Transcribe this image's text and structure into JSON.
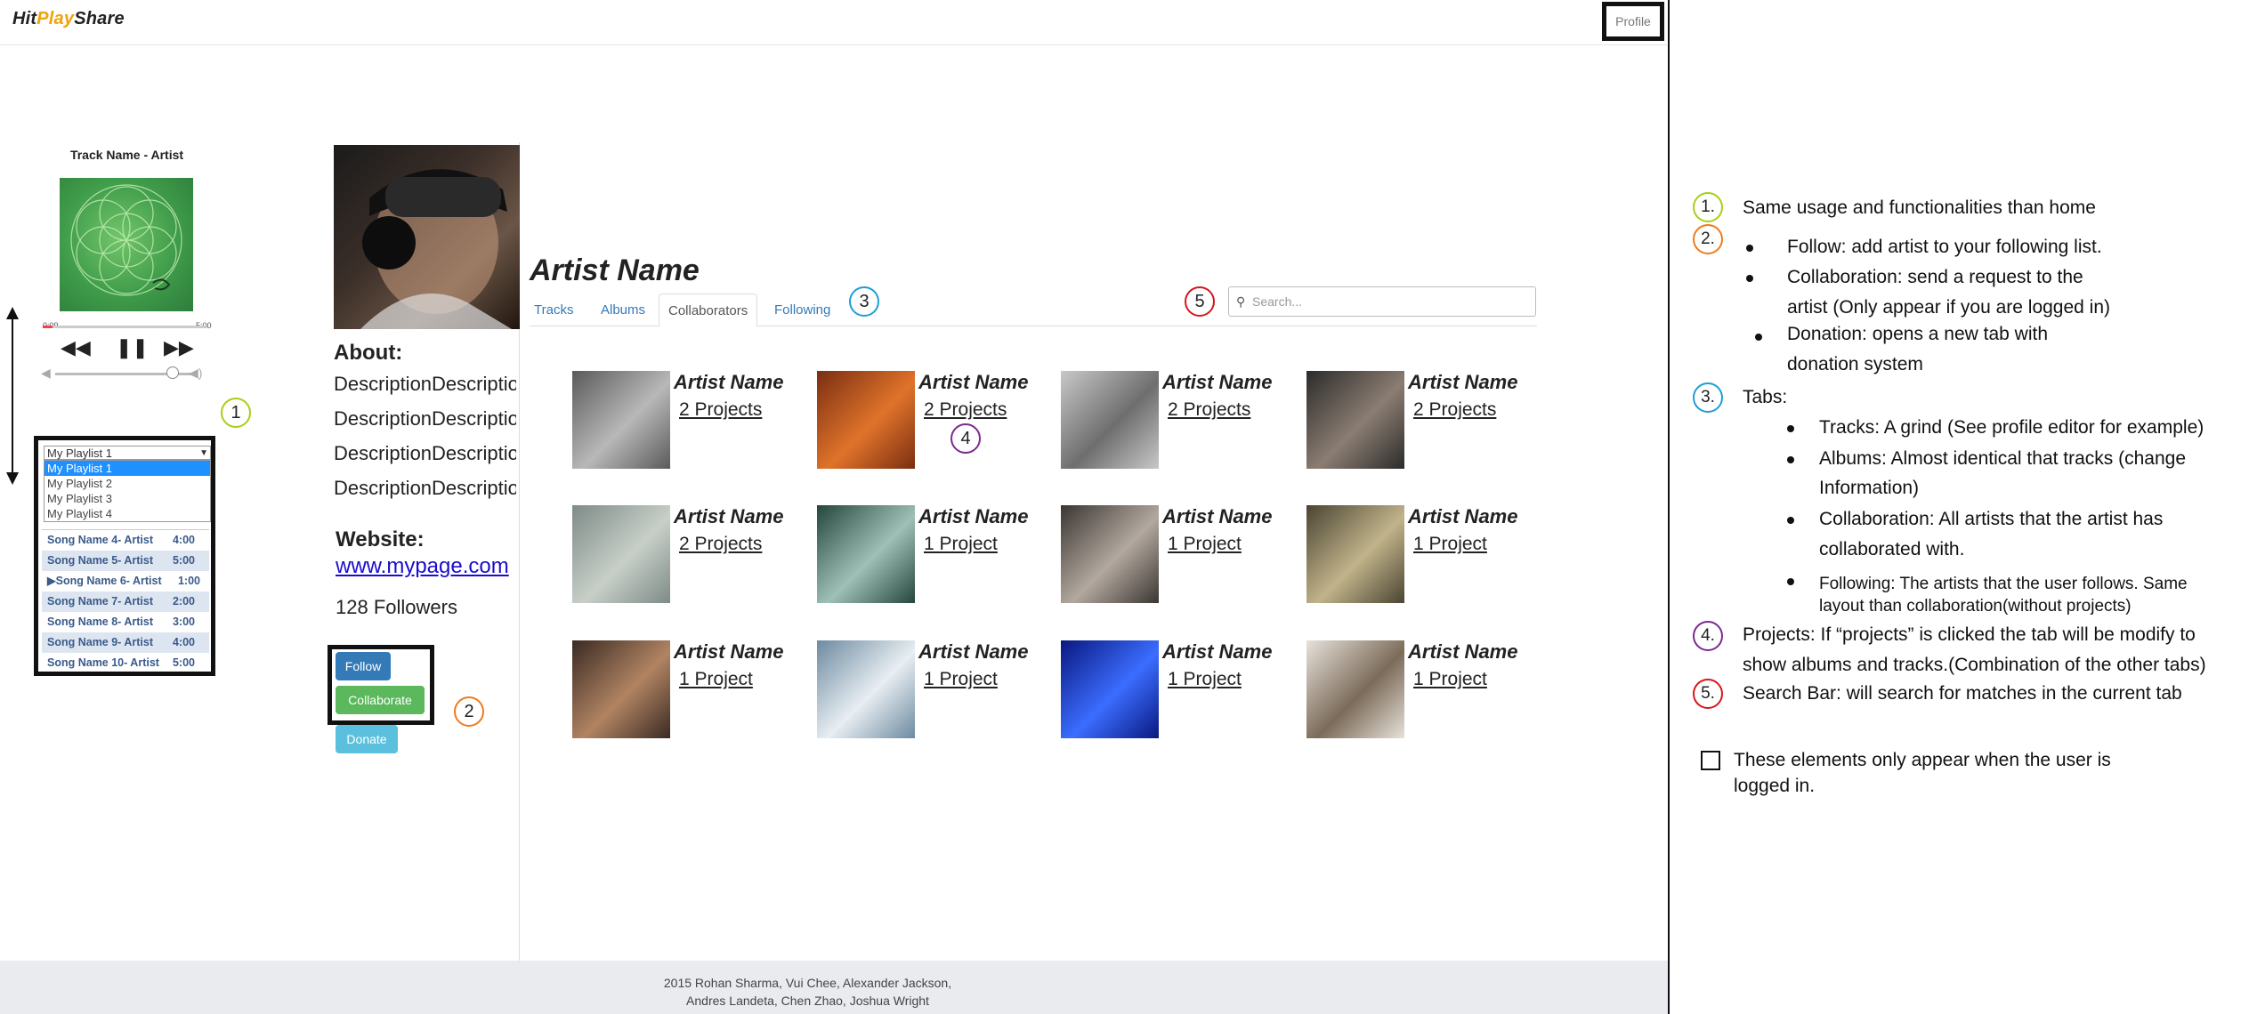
{
  "header": {
    "logo_hit": "Hit",
    "logo_play": "Play",
    "logo_share": "Share",
    "profile_label": "Profile"
  },
  "player": {
    "track_title": "Track Name - Artist",
    "time_start": "0:09",
    "time_end": "5:00",
    "progress": 0.06,
    "volume": 0.82,
    "prev_icon": "rewind-icon",
    "pause_icon": "pause-icon",
    "next_icon": "fast-forward-icon",
    "selected_playlist": "My Playlist 1",
    "playlist_options": [
      "My Playlist 1",
      "My Playlist 2",
      "My Playlist 3",
      "My Playlist 4"
    ],
    "songs": [
      {
        "title": "Song Name 4- Artist",
        "duration": "4:00"
      },
      {
        "title": "Song Name 5- Artist",
        "duration": "5:00"
      },
      {
        "title": "Song Name 6- Artist",
        "duration": "1:00",
        "playing": true
      },
      {
        "title": "Song Name 7- Artist",
        "duration": "2:00"
      },
      {
        "title": "Song Name 8- Artist",
        "duration": "3:00"
      },
      {
        "title": "Song Name 9- Artist",
        "duration": "4:00"
      },
      {
        "title": "Song Name 10- Artist",
        "duration": "5:00"
      }
    ],
    "playing_marker": "▶"
  },
  "profile": {
    "about_label": "About:",
    "description_lines": [
      "DescriptionDescription",
      "DescriptionDescription",
      "DescriptionDescription",
      "DescriptionDescription"
    ],
    "website_label": "Website:",
    "website_url": "www.mypage.com",
    "followers": "128 Followers",
    "follow_label": "Follow",
    "collaborate_label": "Collaborate",
    "donate_label": "Donate"
  },
  "main": {
    "artist_name": "Artist Name",
    "tabs": [
      "Tracks",
      "Albums",
      "Collaborators",
      "Following"
    ],
    "active_tab": "Collaborators",
    "search_placeholder": "Search...",
    "collaborators": [
      {
        "name": "Artist Name",
        "projects": "2 Projects"
      },
      {
        "name": "Artist Name",
        "projects": "2 Projects"
      },
      {
        "name": "Artist Name",
        "projects": "2 Projects"
      },
      {
        "name": "Artist Name",
        "projects": "2 Projects"
      },
      {
        "name": "Artist Name",
        "projects": "2 Projects"
      },
      {
        "name": "Artist Name",
        "projects": "1 Project"
      },
      {
        "name": "Artist Name",
        "projects": "1 Project"
      },
      {
        "name": "Artist Name",
        "projects": "1 Project"
      },
      {
        "name": "Artist Name",
        "projects": "1 Project"
      },
      {
        "name": "Artist Name",
        "projects": "1 Project"
      },
      {
        "name": "Artist Name",
        "projects": "1 Project"
      },
      {
        "name": "Artist Name",
        "projects": "1 Project"
      }
    ]
  },
  "callouts": {
    "one": "1",
    "two": "2",
    "three": "3",
    "four": "4",
    "five": "5"
  },
  "footer": {
    "line1": "2015 Rohan Sharma, Vui Chee, Alexander Jackson,",
    "line2": "Andres Landeta, Chen Zhao, Joshua Wright"
  },
  "notes": {
    "n1_num": "1.",
    "n1_text": "Same usage and functionalities than home",
    "n2_num": "2.",
    "n2_follow": "Follow: add artist to your following list.",
    "n2_collab_a": "Collaboration: send a request to the",
    "n2_collab_b": "artist (Only appear if you are logged in)",
    "n2_donation_a": "Donation:  opens a new tab with",
    "n2_donation_b": "donation system",
    "n3_num": "3.",
    "n3_text": "Tabs:",
    "n3_tracks": "Tracks: A grind (See profile editor for example)",
    "n3_albums_a": "Albums: Almost identical that tracks (change",
    "n3_albums_b": "Information)",
    "n3_collab_a": "Collaboration: All artists  that the artist has",
    "n3_collab_b": "collaborated with.",
    "n3_following_a": "Following: The artists  that the user follows. Same",
    "n3_following_b": "layout than collaboration(without projects)",
    "n4_num": "4.",
    "n4_a": "Projects:  If “projects” is clicked the tab will be modify to",
    "n4_b": "show albums and tracks.(Combination of the other tabs)",
    "n5_num": "5.",
    "n5_text": "Search Bar: will search for matches in the current tab",
    "legend_a": "These elements only appear when the user is",
    "legend_b": "logged in."
  },
  "colors": {
    "follow": "#337ab7",
    "collaborate": "#5cb85c",
    "donate": "#5bc0de",
    "link": "#337ab7",
    "callout_1": "#a6d014",
    "callout_2": "#f07a1a",
    "callout_3": "#1e9ed6",
    "callout_4": "#7b2a8e",
    "callout_5": "#d6161c"
  }
}
